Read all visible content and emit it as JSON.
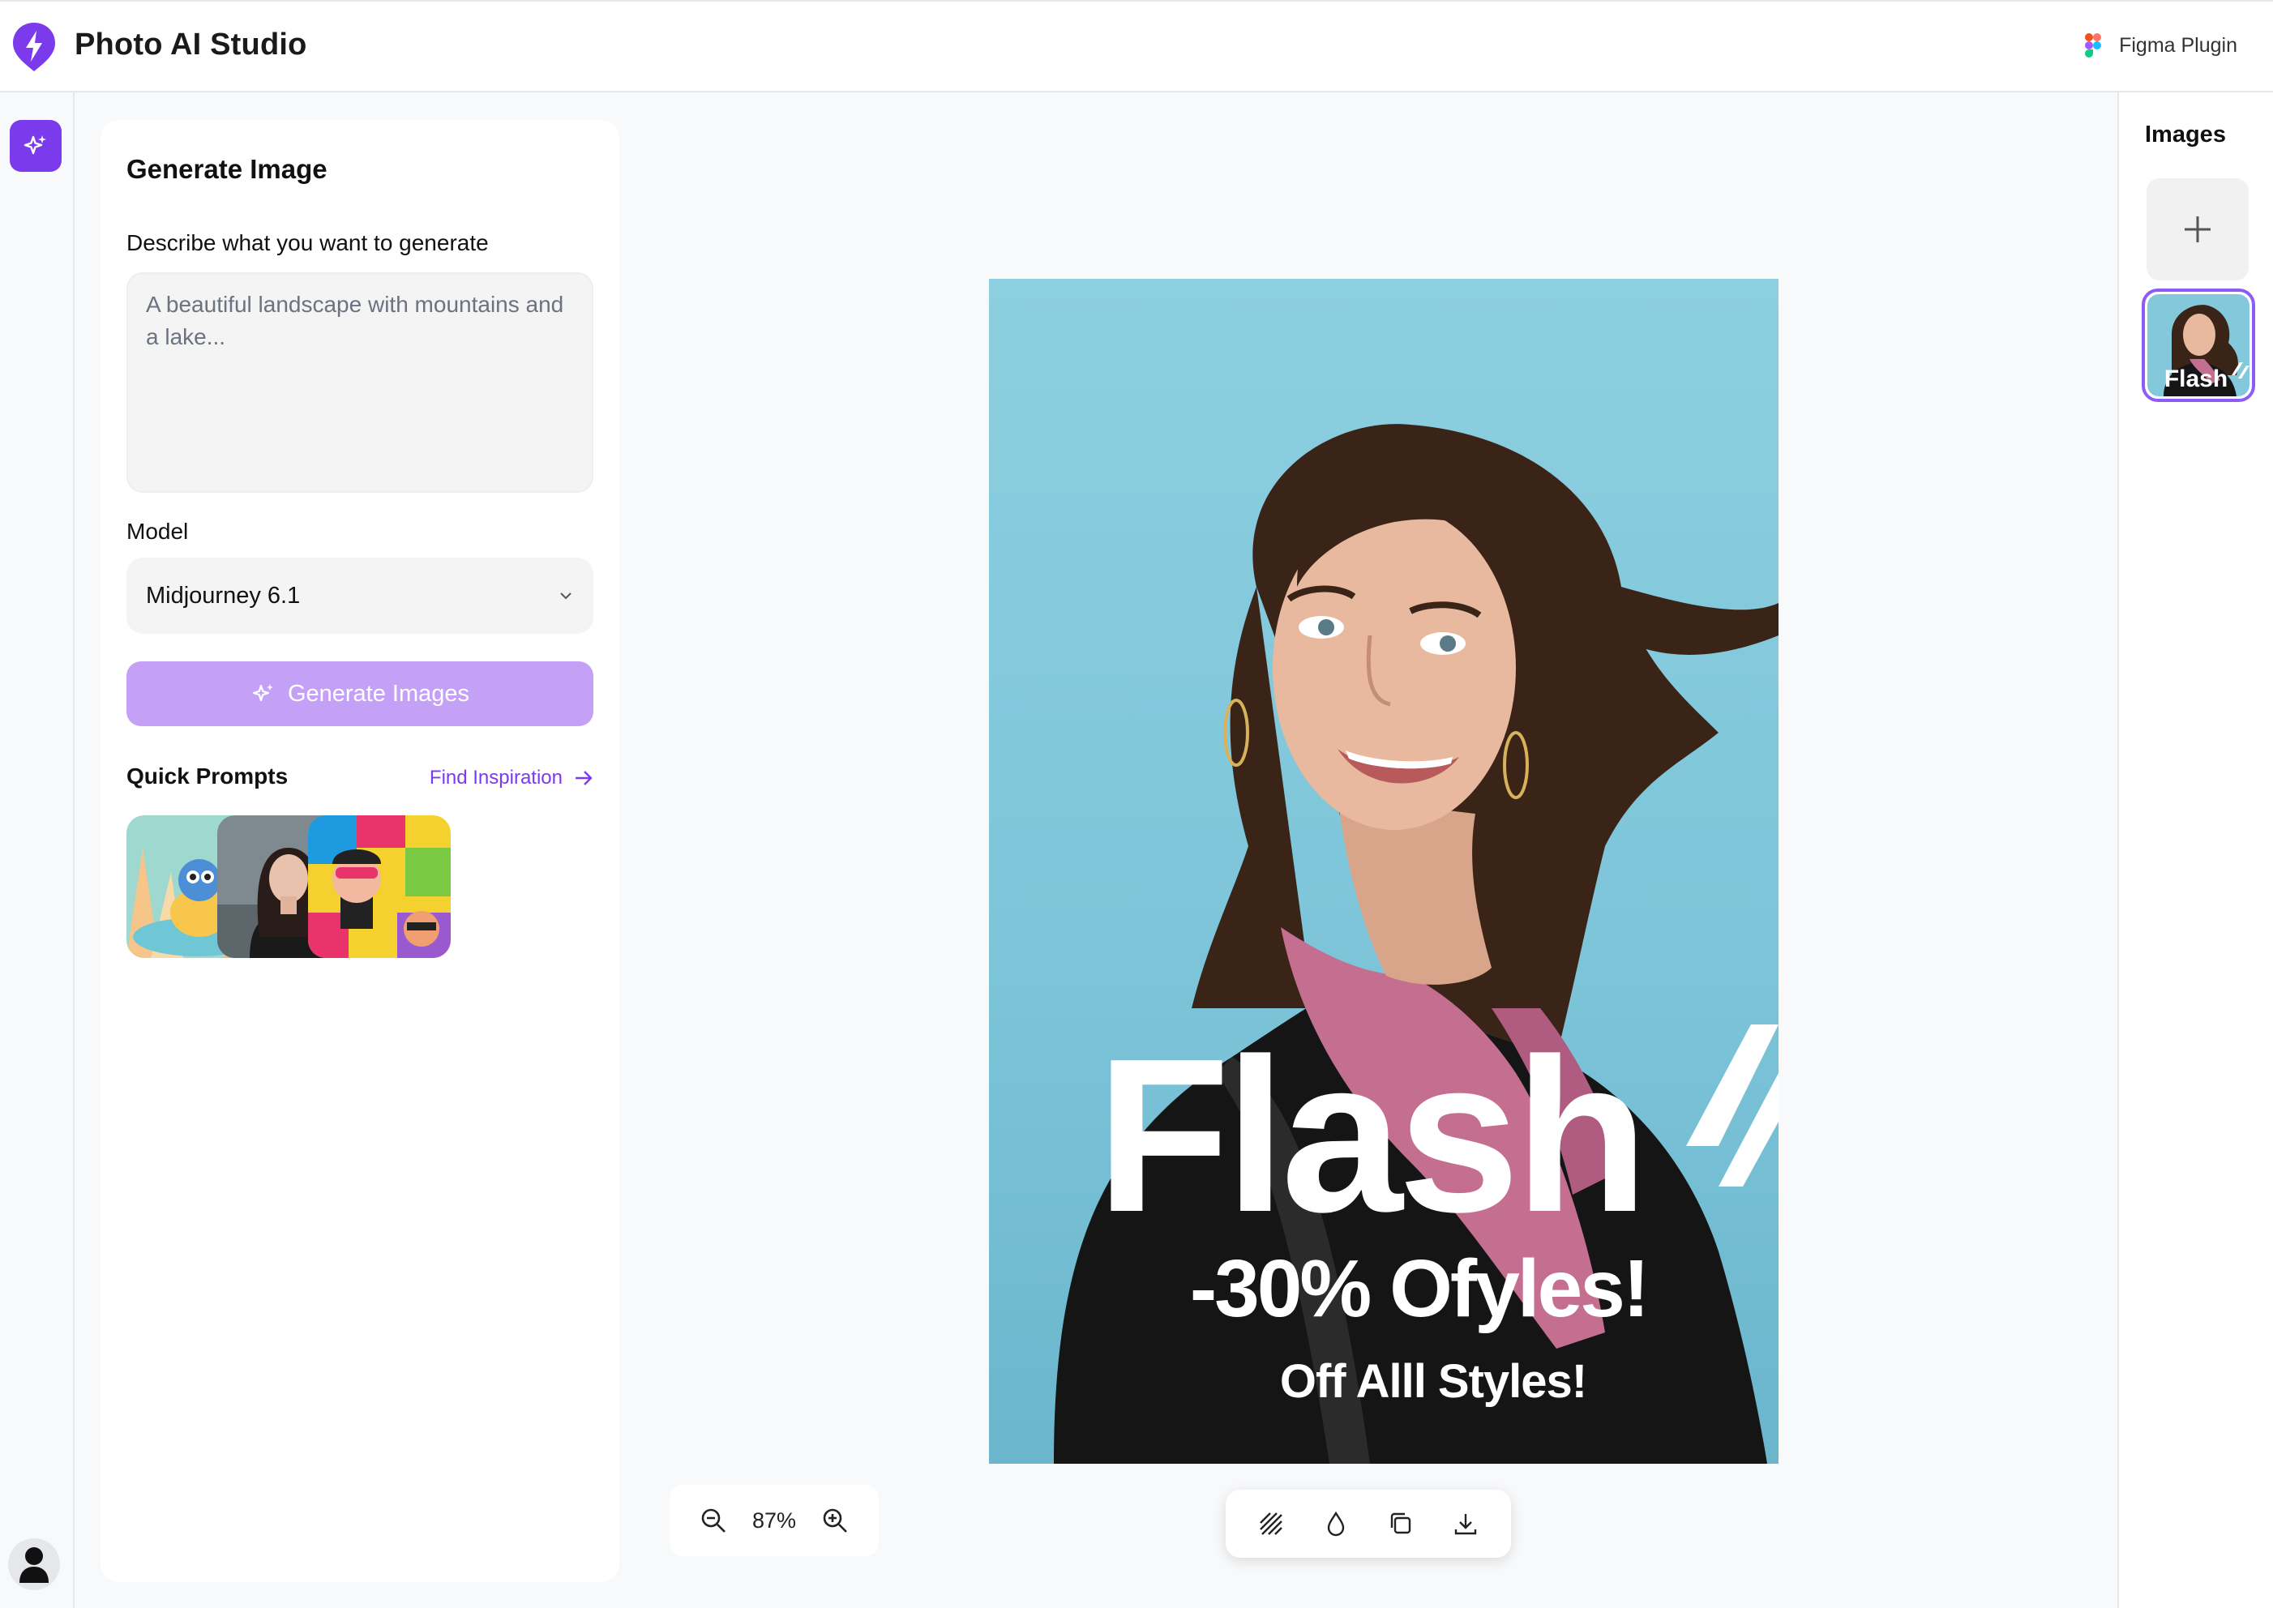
{
  "app": {
    "title": "Photo AI Studio",
    "figma_label": "Figma Plugin",
    "accent": "#7c3aed"
  },
  "panel": {
    "title": "Generate Image",
    "prompt_label": "Describe what you want to generate",
    "prompt_placeholder": "A beautiful landscape with mountains and a lake...",
    "model_label": "Model",
    "model_value": "Midjourney 6.1",
    "generate_label": "Generate Images",
    "quick_prompts_label": "Quick Prompts",
    "find_inspiration": "Find Inspiration"
  },
  "poster": {
    "headline": "Flash",
    "line2": "-30% Ofyles!",
    "line3": "Off Alll Styles!"
  },
  "zoom": {
    "level": "87%"
  },
  "images_panel": {
    "title": "Images",
    "thumb_text": "Flash"
  },
  "icons": [
    "logo-bolt-icon",
    "figma-icon",
    "sparkle-icon",
    "user-icon",
    "chevron-down-icon",
    "arrow-right-icon",
    "zoom-out-icon",
    "zoom-in-icon",
    "pattern-icon",
    "drop-icon",
    "copy-icon",
    "download-icon",
    "plus-icon"
  ]
}
